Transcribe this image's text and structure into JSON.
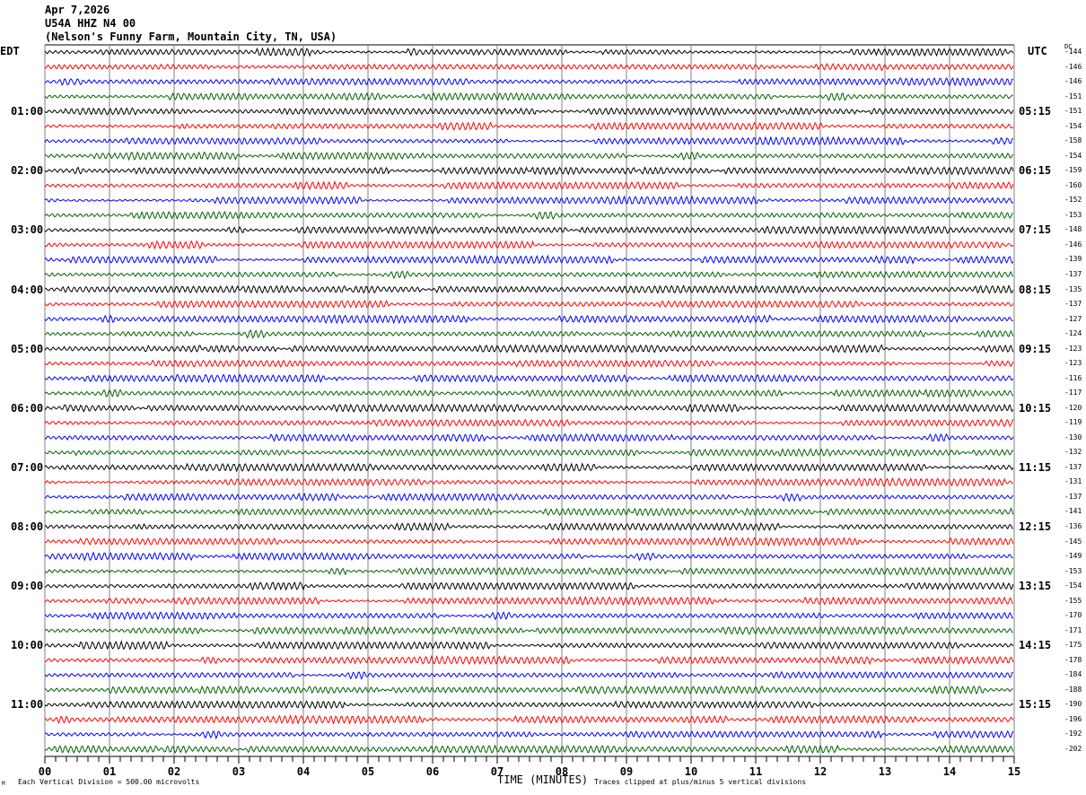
{
  "header": {
    "date": "Apr 7,2026",
    "station": "U54A HHZ N4 00",
    "location": "(Nelson's Funny Farm, Mountain City, TN, USA)"
  },
  "left_tz": "EDT",
  "right_tz": "UTC",
  "dc_label": "DC",
  "footer": {
    "corner_mark": "M",
    "scale_text": "Each Vertical Division =  500.00 microvolts",
    "xlabel": "TIME (MINUTES)",
    "clip_text": "Traces clipped at plus/minus 5 vertical divisions"
  },
  "chart_data": {
    "type": "line",
    "title": "Apr 7,2026 U54A HHZ N4 00",
    "xlabel": "TIME (MINUTES)",
    "xlim": [
      0,
      15
    ],
    "x_ticks": [
      "00",
      "01",
      "02",
      "03",
      "04",
      "05",
      "06",
      "07",
      "08",
      "09",
      "10",
      "11",
      "12",
      "13",
      "14",
      "15"
    ],
    "trace_colors": [
      "#000000",
      "#ff0000",
      "#0000ff",
      "#006400"
    ],
    "trace_count": 48,
    "minutes_per_trace": 15,
    "left_time_labels": [
      {
        "trace": 4,
        "label": "01:00"
      },
      {
        "trace": 8,
        "label": "02:00"
      },
      {
        "trace": 12,
        "label": "03:00"
      },
      {
        "trace": 16,
        "label": "04:00"
      },
      {
        "trace": 20,
        "label": "05:00"
      },
      {
        "trace": 24,
        "label": "06:00"
      },
      {
        "trace": 28,
        "label": "07:00"
      },
      {
        "trace": 32,
        "label": "08:00"
      },
      {
        "trace": 36,
        "label": "09:00"
      },
      {
        "trace": 40,
        "label": "10:00"
      },
      {
        "trace": 44,
        "label": "11:00"
      }
    ],
    "right_time_labels": [
      {
        "trace": 4,
        "label": "05:15"
      },
      {
        "trace": 8,
        "label": "06:15"
      },
      {
        "trace": 12,
        "label": "07:15"
      },
      {
        "trace": 16,
        "label": "08:15"
      },
      {
        "trace": 20,
        "label": "09:15"
      },
      {
        "trace": 24,
        "label": "10:15"
      },
      {
        "trace": 28,
        "label": "11:15"
      },
      {
        "trace": 32,
        "label": "12:15"
      },
      {
        "trace": 36,
        "label": "13:15"
      },
      {
        "trace": 40,
        "label": "14:15"
      },
      {
        "trace": 44,
        "label": "15:15"
      }
    ],
    "dc_offsets": [
      -144,
      -146,
      -146,
      -151,
      -151,
      -154,
      -158,
      -154,
      -159,
      -160,
      -152,
      -153,
      -148,
      -146,
      -139,
      -137,
      -135,
      -137,
      -127,
      -124,
      -123,
      -123,
      -116,
      -117,
      -120,
      -119,
      -130,
      -132,
      -137,
      -131,
      -137,
      -141,
      -136,
      -145,
      -149,
      -153,
      -154,
      -155,
      -170,
      -171,
      -175,
      -178,
      -184,
      -188,
      -190,
      -196,
      -192,
      -202
    ],
    "vertical_division_microvolts": 500.0,
    "clip_divisions": 5
  }
}
